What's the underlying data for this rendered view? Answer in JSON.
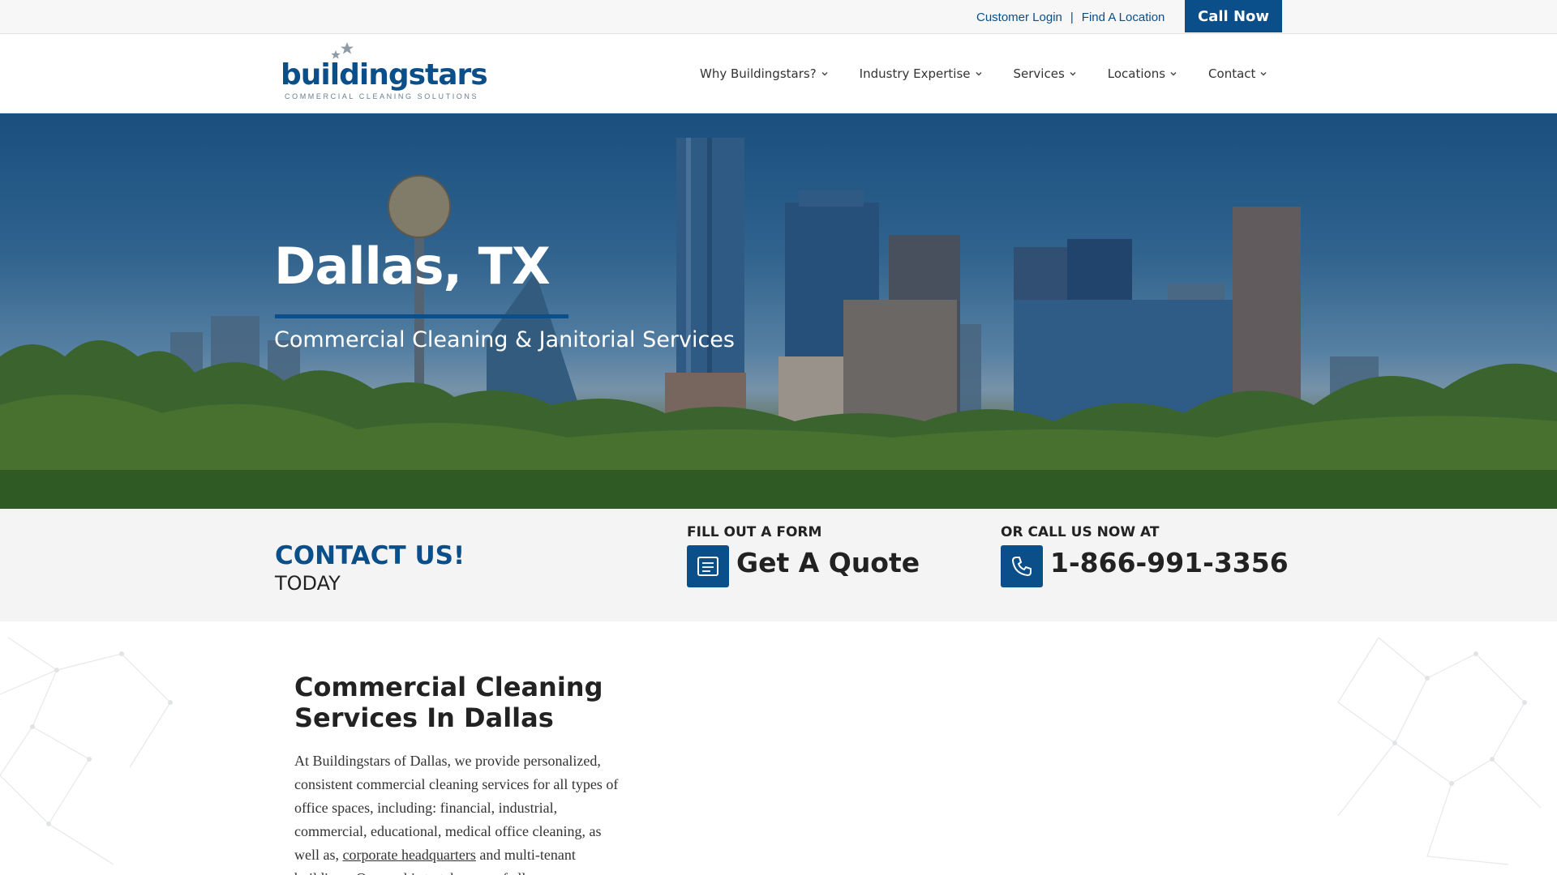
{
  "topbar": {
    "customer_login": "Customer Login",
    "separator": "|",
    "find_location": "Find A Location",
    "call_now": "Call Now"
  },
  "logo": {
    "word": "buildingstars",
    "tagline": "COMMERCIAL CLEANING SOLUTIONS"
  },
  "nav": {
    "items": [
      {
        "label": "Why Buildingstars?",
        "icon": "chevron-down-icon"
      },
      {
        "label": "Industry Expertise",
        "icon": "chevron-down-icon"
      },
      {
        "label": "Services",
        "icon": "chevron-down-icon"
      },
      {
        "label": "Locations",
        "icon": "chevron-down-icon"
      },
      {
        "label": "Contact",
        "icon": "chevron-down-icon"
      }
    ]
  },
  "hero": {
    "title": "Dallas, TX",
    "subtitle": "Commercial Cleaning & Janitorial Services"
  },
  "contact": {
    "title": "CONTACT US!",
    "subtitle": "TODAY",
    "form_label": "FILL OUT A FORM",
    "form_cta": "Get A Quote",
    "form_icon": "form-icon",
    "call_label": "OR CALL US NOW AT",
    "phone": "1-866-991-3356",
    "phone_icon": "phone-icon"
  },
  "main": {
    "heading": "Commercial Cleaning Services In Dallas",
    "para_before_link": "At Buildingstars of Dallas, we provide personalized, consistent commercial cleaning services for all types of office spaces, including: financial, industrial, commercial, educational, medical office cleaning, as well as, ",
    "para_link": "corporate headquarters",
    "para_after_link": " and multi-tenant buildings. Our goal is to take care of all"
  },
  "colors": {
    "brand_blue": "#0b4f8a",
    "topbar_bg": "#f7f7f7",
    "contact_bg": "#f4f4f4"
  }
}
